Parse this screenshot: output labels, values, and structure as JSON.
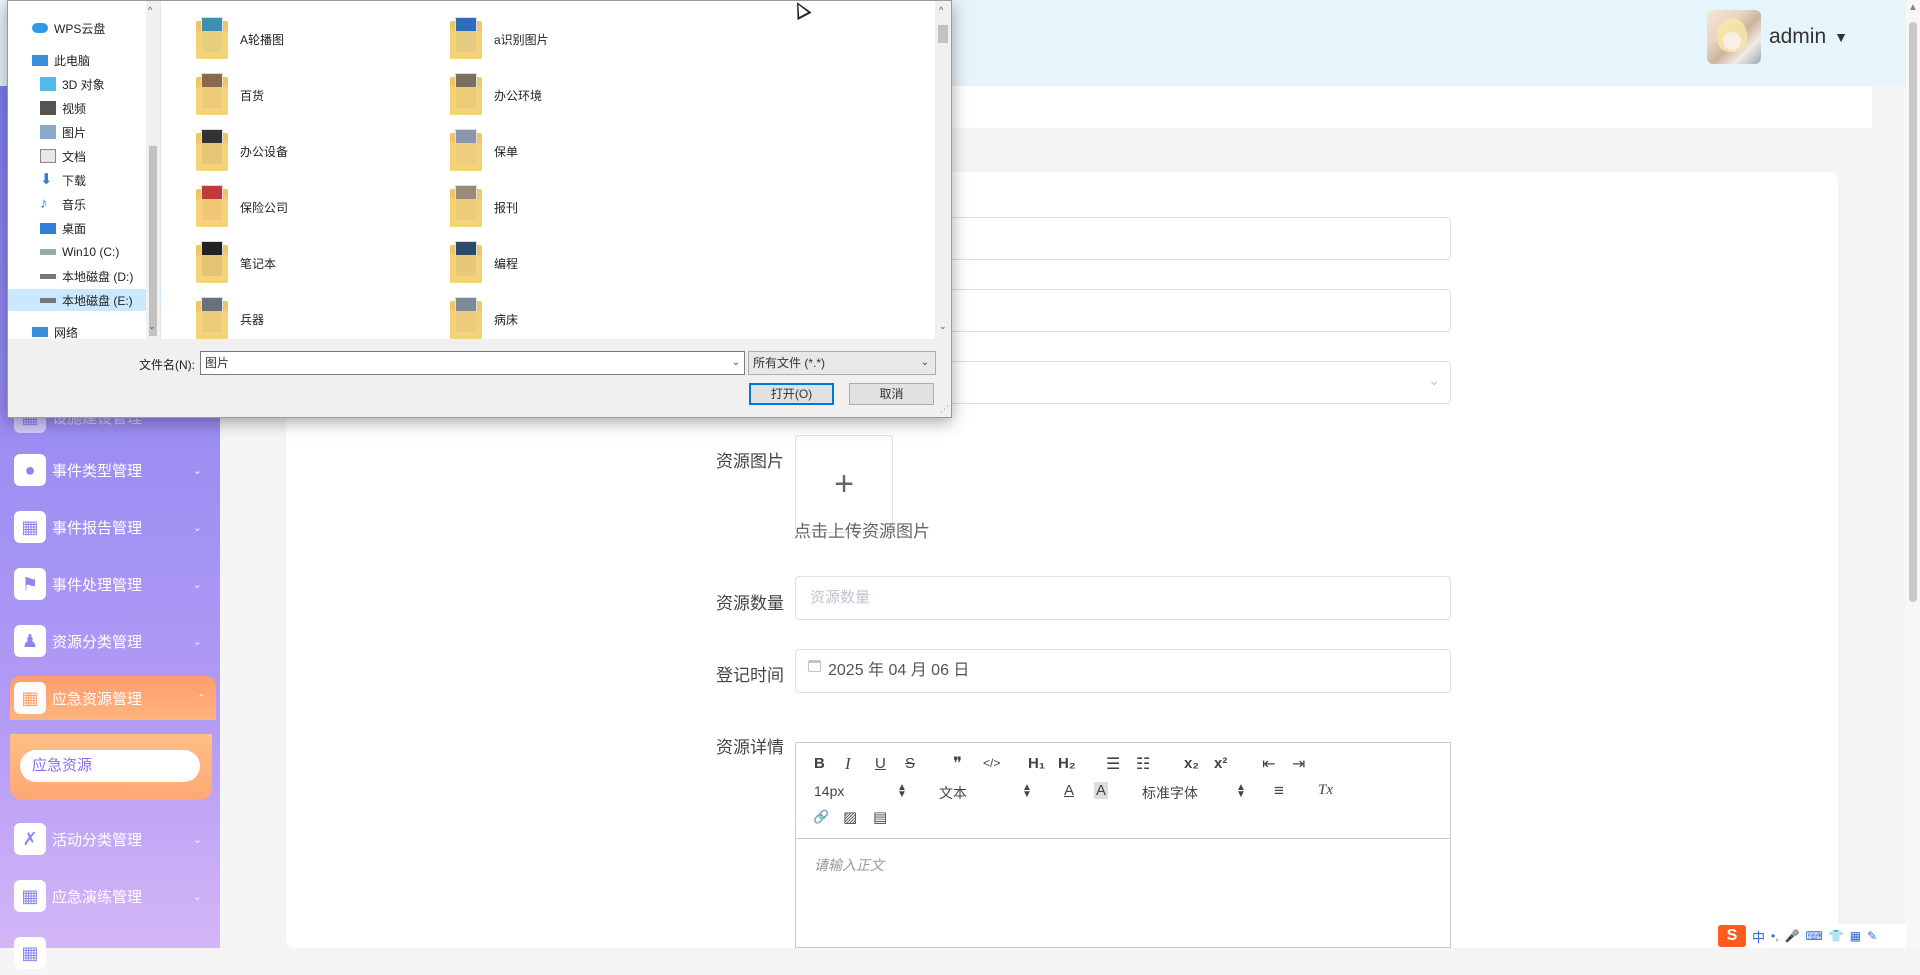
{
  "header": {
    "user_name": "admin",
    "caret": "▼"
  },
  "sidebar": {
    "items": [
      {
        "label": "事件类型管理",
        "icon": "bulb-icon",
        "glyph": "●"
      },
      {
        "label": "事件报告管理",
        "icon": "grid-icon",
        "glyph": "▦"
      },
      {
        "label": "事件处理管理",
        "icon": "flag-icon",
        "glyph": "⚑"
      },
      {
        "label": "资源分类管理",
        "icon": "person-icon",
        "glyph": "♟"
      },
      {
        "label": "应急资源管理",
        "icon": "grid-icon",
        "glyph": "▦",
        "active": true
      },
      {
        "label": "活动分类管理",
        "icon": "clipboard-icon",
        "glyph": "✗"
      },
      {
        "label": "应急演练管理",
        "icon": "grid-icon",
        "glyph": "▦"
      }
    ],
    "partial_label": "设施建设管理",
    "arrow": "⌄",
    "arrow_up": "⌃",
    "sub_item": "应急资源",
    "accent": "#ff9f6e"
  },
  "form": {
    "image_label": "资源图片",
    "upload_plus": "+",
    "upload_hint": "点击上传资源图片",
    "quantity_label": "资源数量",
    "quantity_placeholder": "资源数量",
    "date_label": "登记时间",
    "date_value": "2025 年 04 月 06 日",
    "detail_label": "资源详情",
    "select_caret": "⌄"
  },
  "editor": {
    "bold": "B",
    "italic": "I",
    "underline": "U",
    "strike": "S",
    "quote": "❞",
    "code": "</>",
    "h1": "H₁",
    "h2": "H₂",
    "ol": "☰",
    "ul": "☷",
    "sub": "x₂",
    "sup": "x²",
    "outdent": "⇤",
    "indent": "⇥",
    "font_size": "14px",
    "block_type": "文本",
    "color": "A",
    "bg_color": "A",
    "font_family": "标准字体",
    "align": "≡",
    "clear": "Tx",
    "link": "🔗",
    "image": "▨",
    "video": "▤",
    "placeholder": "请输入正文"
  },
  "dialog": {
    "nav": [
      {
        "label": "WPS云盘",
        "icon": "cloud-icon"
      },
      {
        "label": "此电脑",
        "icon": "computer-icon"
      },
      {
        "label": "3D 对象",
        "icon": "cube-icon"
      },
      {
        "label": "视频",
        "icon": "video-icon"
      },
      {
        "label": "图片",
        "icon": "picture-icon"
      },
      {
        "label": "文档",
        "icon": "document-icon"
      },
      {
        "label": "下载",
        "icon": "download-icon"
      },
      {
        "label": "音乐",
        "icon": "music-icon"
      },
      {
        "label": "桌面",
        "icon": "desktop-icon"
      },
      {
        "label": "Win10 (C:)",
        "icon": "drive-icon"
      },
      {
        "label": "本地磁盘 (D:)",
        "icon": "drive-icon"
      },
      {
        "label": "本地磁盘 (E:)",
        "icon": "drive-icon",
        "selected": true
      },
      {
        "label": "网络",
        "icon": "network-icon"
      }
    ],
    "files": [
      {
        "label": "A轮播图",
        "tint": "#3d8fb0"
      },
      {
        "label": "a识别图片",
        "tint": "#2a6fb8"
      },
      {
        "label": "百货",
        "tint": "#8a6a4a"
      },
      {
        "label": "办公环境",
        "tint": "#7a7060"
      },
      {
        "label": "办公设备",
        "tint": "#333333"
      },
      {
        "label": "保单",
        "tint": "#8a96b0"
      },
      {
        "label": "保险公司",
        "tint": "#c23b3b"
      },
      {
        "label": "报刊",
        "tint": "#9a8a7a"
      },
      {
        "label": "笔记本",
        "tint": "#222222"
      },
      {
        "label": "编程",
        "tint": "#2a4a6a"
      },
      {
        "label": "兵器",
        "tint": "#6a7080"
      },
      {
        "label": "病床",
        "tint": "#7a8a9a"
      }
    ],
    "filename_label": "文件名(N):",
    "filename_value": "图片",
    "filetype_value": "所有文件 (*.*)",
    "open_label": "打开(O)",
    "cancel_label": "取消",
    "caret": "⌄",
    "up": "^",
    "down": "⌄"
  },
  "tray": {
    "ime_logo": "S",
    "ime_lang": "中",
    "items": [
      "•,",
      "🎤",
      "⌨",
      "👕",
      "▦",
      "✎"
    ]
  }
}
